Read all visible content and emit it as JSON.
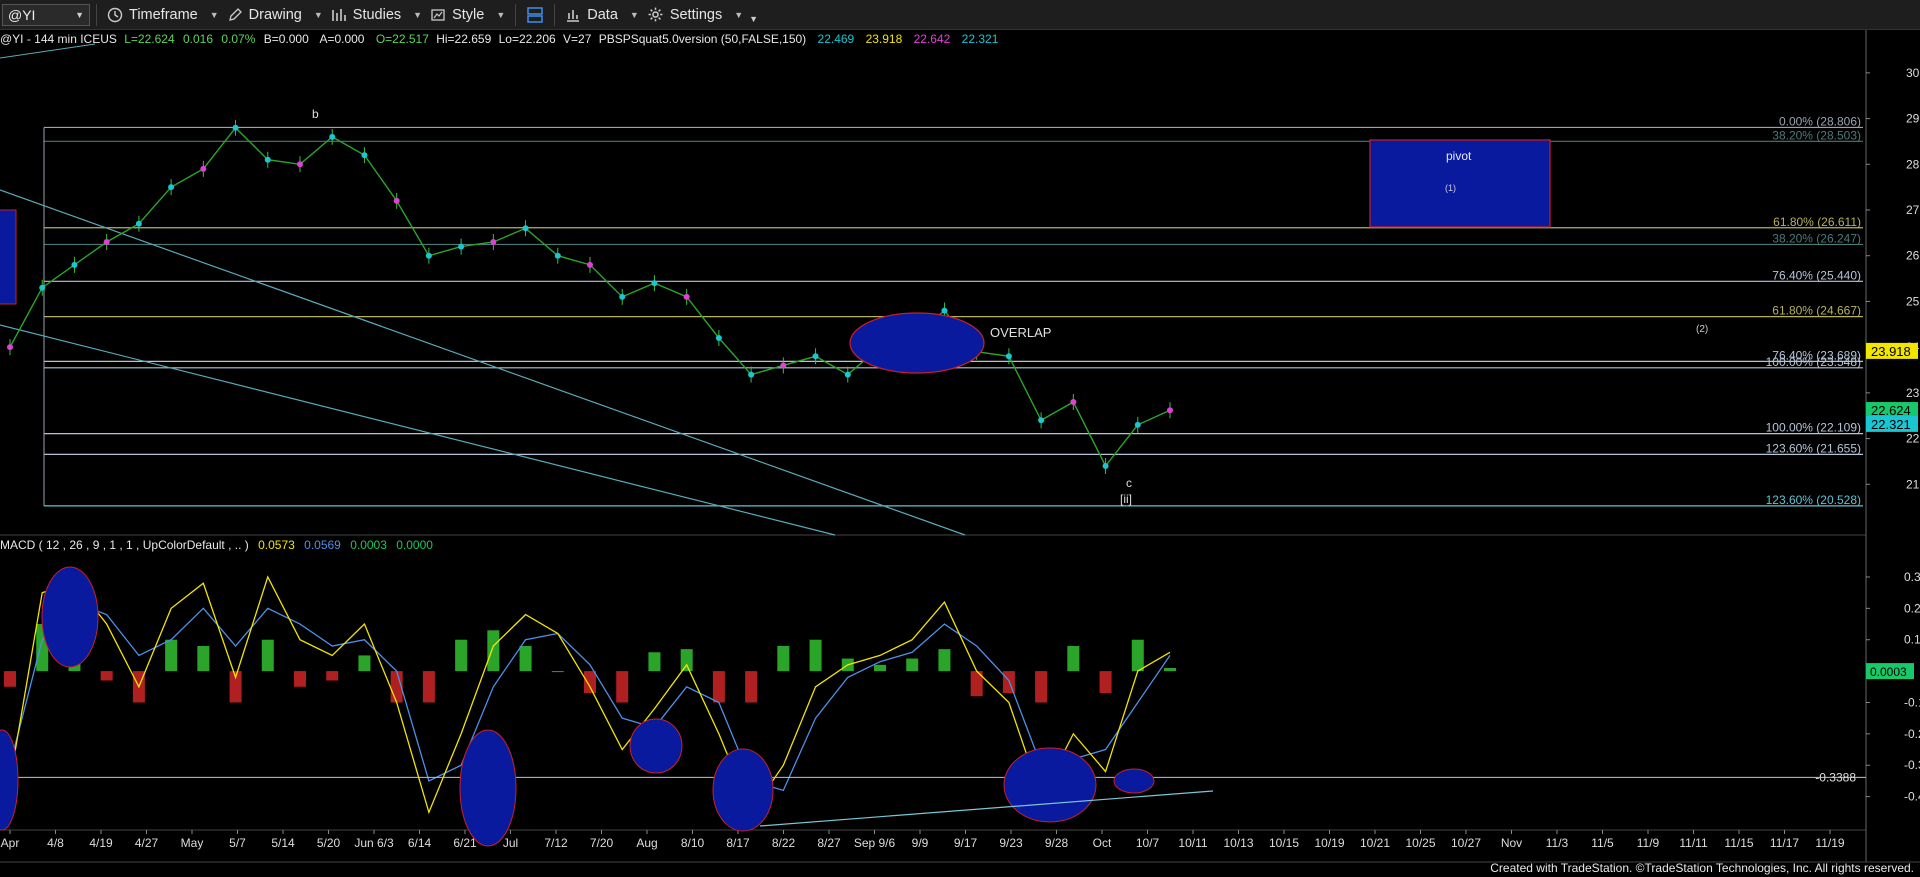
{
  "toolbar": {
    "symbol": "@YI",
    "items": [
      {
        "label": "Timeframe",
        "icon": "clock-icon"
      },
      {
        "label": "Drawing",
        "icon": "pencil-icon"
      },
      {
        "label": "Studies",
        "icon": "studies-icon"
      },
      {
        "label": "Style",
        "icon": "style-icon"
      },
      {
        "label": "",
        "icon": "layout-icon"
      },
      {
        "label": "Data",
        "icon": "data-icon"
      },
      {
        "label": "Settings",
        "icon": "gear-icon"
      }
    ]
  },
  "chart_data": [
    {
      "type": "line",
      "subtype": "price-bars",
      "header": {
        "title": "@YI - 144 min ICEUS",
        "L": "L=22.624",
        "chg": "0.016",
        "pct": "0.07%",
        "B": "B=0.000",
        "A": "A=0.000",
        "O": "O=22.517",
        "Hi": "Hi=22.659",
        "Lo": "Lo=22.206",
        "V": "V=27",
        "study": "PBSPSquat5.0version (50,FALSE,150)",
        "vals": [
          "22.469",
          "23.918",
          "22.642",
          "22.321"
        ]
      },
      "ylim": [
        20,
        30.5
      ],
      "y_ticks": [
        "30.000",
        "29.000",
        "28.000",
        "27.000",
        "26.000",
        "25.000",
        "24.000",
        "23.000",
        "22.000",
        "21.000"
      ],
      "x_labels": [
        "Apr",
        "4/8",
        "4/19",
        "4/27",
        "May",
        "5/7",
        "5/14",
        "5/20",
        "Jun 6/3",
        "6/14",
        "6/21",
        "Jul",
        "7/12",
        "7/20",
        "Aug",
        "8/10",
        "8/17",
        "8/22",
        "8/27",
        "Sep 9/6",
        "9/9",
        "9/17",
        "9/23",
        "9/28",
        "Oct",
        "10/7",
        "10/11",
        "10/13",
        "10/15",
        "10/19",
        "10/21",
        "10/25",
        "10/27",
        "Nov",
        "11/3",
        "11/5",
        "11/9",
        "11/11",
        "11/15",
        "11/17",
        "11/19"
      ],
      "fib_levels": [
        {
          "label": "0.00% (28.806)",
          "value": 28.806,
          "color": "#9aa4b0"
        },
        {
          "label": "38.20% (28.503)",
          "value": 28.503,
          "color": "#4a7a78"
        },
        {
          "label": "61.80% (26.611)",
          "value": 26.611,
          "color": "#b9b15a"
        },
        {
          "label": "38.20% (26.247)",
          "value": 26.247,
          "color": "#4a7a78"
        },
        {
          "label": "76.40% (25.440)",
          "value": 25.44,
          "color": "#b5c4d8"
        },
        {
          "label": "61.80% (24.667)",
          "value": 24.667,
          "color": "#b9b15a"
        },
        {
          "label": "76.40% (23.689)",
          "value": 23.689,
          "color": "#b5c4d8"
        },
        {
          "label": "100.00% (23.548)",
          "value": 23.548,
          "color": "#b5c4d8"
        },
        {
          "label": "100.00% (22.109)",
          "value": 22.109,
          "color": "#b5c4d8"
        },
        {
          "label": "123.60% (21.655)",
          "value": 21.655,
          "color": "#b5c4d8"
        },
        {
          "label": "123.60% (20.528)",
          "value": 20.528,
          "color": "#5fc4d6"
        }
      ],
      "annotations": {
        "b": "b",
        "c": "c",
        "ii": "[ii]",
        "overlap": "OVERLAP",
        "pivot": "pivot",
        "one": "(1)",
        "two": "(2)"
      },
      "price_tags": [
        {
          "text": "23.918",
          "value": 23.918,
          "bg": "#f2e600",
          "fg": "#000"
        },
        {
          "text": "22.624",
          "value": 22.624,
          "bg": "#18c96a",
          "fg": "#000"
        },
        {
          "text": "22.321",
          "value": 22.321,
          "bg": "#19c6d2",
          "fg": "#000"
        }
      ],
      "series": [
        {
          "name": "Price",
          "x": [
            "4/4",
            "4/8",
            "4/19",
            "4/27",
            "5/3",
            "5/7",
            "5/14",
            "5/17",
            "5/20",
            "5/28",
            "6/3",
            "6/10",
            "6/14",
            "6/21",
            "6/28",
            "7/3",
            "7/8",
            "7/12",
            "7/17",
            "7/20",
            "7/25",
            "7/31",
            "8/5",
            "8/10",
            "8/14",
            "8/17",
            "8/22",
            "8/27",
            "9/3",
            "9/6",
            "9/9",
            "9/13",
            "9/17",
            "9/23",
            "9/28",
            "10/3",
            "10/7"
          ],
          "values": [
            24.0,
            25.3,
            25.8,
            26.3,
            26.7,
            27.5,
            27.9,
            28.8,
            28.1,
            28.0,
            28.6,
            28.2,
            27.2,
            26.0,
            26.2,
            26.3,
            26.6,
            26.0,
            25.8,
            25.1,
            25.4,
            25.1,
            24.2,
            23.4,
            23.6,
            23.8,
            23.4,
            24.0,
            24.2,
            24.8,
            23.9,
            23.8,
            22.4,
            22.8,
            21.4,
            22.3,
            22.62
          ]
        }
      ]
    },
    {
      "type": "line",
      "subtype": "macd",
      "header": {
        "title": "MACD ( 12 , 26 , 9 , 1 , 1 , UpColorDefault , .. )",
        "v1": "0.0573",
        "v2": "0.0569",
        "v3": "0.0003",
        "v4": "0.0000"
      },
      "ylim": [
        -0.5,
        0.37
      ],
      "y_ticks": [
        "0.3000",
        "0.2000",
        "0.1000",
        "-0.1000",
        "-0.2000",
        "-0.3000",
        "-0.4000"
      ],
      "ref_line": {
        "label": "-0.3388",
        "value": -0.3388
      },
      "value_tag": {
        "text": "0.0003",
        "bg": "#18c96a"
      },
      "series": [
        {
          "name": "MACD",
          "values": [
            -0.35,
            0.25,
            0.28,
            0.15,
            -0.05,
            0.2,
            0.28,
            -0.02,
            0.3,
            0.1,
            0.05,
            0.15,
            -0.1,
            -0.45,
            -0.2,
            0.08,
            0.18,
            0.12,
            -0.05,
            -0.25,
            -0.12,
            0.02,
            -0.2,
            -0.45,
            -0.3,
            -0.05,
            0.02,
            0.05,
            0.1,
            0.22,
            0.0,
            -0.1,
            -0.4,
            -0.2,
            -0.32,
            0.0,
            0.06
          ]
        },
        {
          "name": "Signal",
          "values": [
            -0.3,
            0.1,
            0.22,
            0.18,
            0.05,
            0.1,
            0.2,
            0.08,
            0.2,
            0.15,
            0.08,
            0.1,
            0.0,
            -0.35,
            -0.3,
            -0.05,
            0.1,
            0.12,
            0.02,
            -0.15,
            -0.18,
            -0.05,
            -0.1,
            -0.35,
            -0.38,
            -0.15,
            -0.02,
            0.03,
            0.06,
            0.15,
            0.08,
            -0.03,
            -0.3,
            -0.28,
            -0.25,
            -0.1,
            0.05
          ]
        }
      ]
    }
  ],
  "footer": {
    "credit": "Created with TradeStation. ©TradeStation Technologies, Inc. All rights reserved."
  }
}
